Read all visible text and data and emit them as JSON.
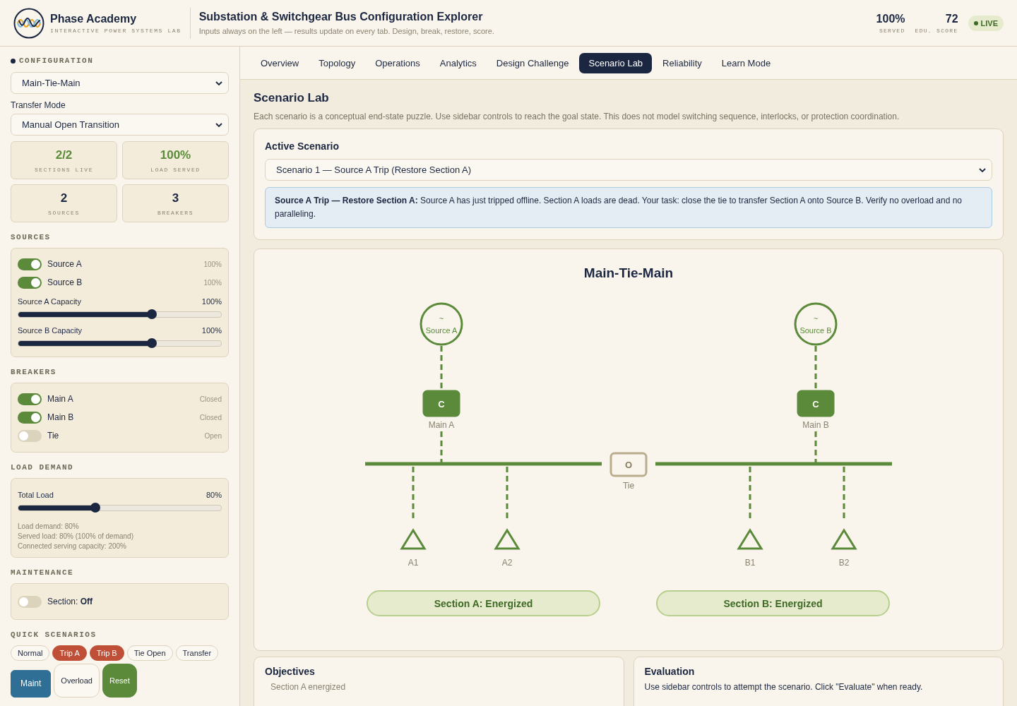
{
  "brand": {
    "name": "Phase Academy",
    "tagline": "INTERACTIVE POWER SYSTEMS LAB"
  },
  "header": {
    "title": "Substation & Switchgear Bus Configuration Explorer",
    "subtitle": "Inputs always on the left — results update on every tab. Design, break, restore, score.",
    "stats": [
      {
        "value": "100%",
        "label": "SERVED"
      },
      {
        "value": "72",
        "label": "EDU. SCORE"
      }
    ],
    "status": {
      "label": "LIVE",
      "on": true
    }
  },
  "sidebar": {
    "configuration": {
      "heading": "CONFIGURATION",
      "value": "Main-Tie-Main",
      "transfer_label": "Transfer Mode",
      "transfer_value": "Manual Open Transition"
    },
    "metrics": [
      {
        "value": "2/2",
        "label": "SECTIONS LIVE",
        "kind": "good"
      },
      {
        "value": "100%",
        "label": "LOAD SERVED",
        "kind": "good"
      },
      {
        "value": "2",
        "label": "SOURCES",
        "kind": "plain"
      },
      {
        "value": "3",
        "label": "BREAKERS",
        "kind": "plain"
      }
    ],
    "sources": {
      "heading": "SOURCES",
      "toggles": [
        {
          "label": "Source A",
          "on": true,
          "reading": "100%"
        },
        {
          "label": "Source B",
          "on": true,
          "reading": "100%"
        }
      ],
      "sliders": [
        {
          "label": "Source A Capacity",
          "reading": "100%",
          "level": 0.66
        },
        {
          "label": "Source B Capacity",
          "reading": "100%",
          "level": 0.66
        }
      ]
    },
    "breakers": {
      "heading": "BREAKERS",
      "toggles": [
        {
          "label": "Main A",
          "on": true,
          "reading": "Closed"
        },
        {
          "label": "Main B",
          "on": true,
          "reading": "Closed"
        },
        {
          "label": "Tie",
          "on": false,
          "reading": "Open"
        }
      ]
    },
    "load_demand": {
      "heading": "LOAD DEMAND",
      "slider": {
        "label": "Total Load",
        "reading": "80%",
        "level": 0.38
      },
      "notes": [
        "Load demand: 80%",
        "Served load: 80% (100% of demand)",
        "Connected serving capacity: 200%"
      ]
    },
    "maintenance": {
      "heading": "MAINTENANCE",
      "toggle": {
        "label": "Section: **Off**",
        "on": false
      }
    },
    "quick_scenarios": {
      "heading": "QUICK SCENARIOS",
      "chips": [
        {
          "label": "Normal",
          "kind": "plain"
        },
        {
          "label": "Trip A",
          "kind": "danger"
        },
        {
          "label": "Trip B",
          "kind": "danger"
        },
        {
          "label": "Tie Open",
          "kind": "plain"
        },
        {
          "label": "Transfer",
          "kind": "plain"
        },
        {
          "label": "Maint",
          "kind": "info"
        },
        {
          "label": "Overload",
          "kind": "plain"
        },
        {
          "label": "Reset",
          "kind": "success"
        }
      ]
    }
  },
  "tabs": [
    {
      "label": "Overview",
      "selected": false
    },
    {
      "label": "Topology",
      "selected": false
    },
    {
      "label": "Operations",
      "selected": false
    },
    {
      "label": "Analytics",
      "selected": false
    },
    {
      "label": "Design Challenge",
      "selected": false
    },
    {
      "label": "Scenario Lab",
      "selected": true
    },
    {
      "label": "Reliability",
      "selected": false
    },
    {
      "label": "Learn Mode",
      "selected": false
    }
  ],
  "scenario_lab": {
    "title": "Scenario Lab",
    "description": "Each scenario is a conceptual end-state puzzle. Use sidebar controls to reach the goal state. This does not model switching sequence, interlocks, or protection coordination.",
    "active": {
      "heading": "Active Scenario",
      "value": "Scenario 1 — Source A Trip (Restore Section A)",
      "info": "**Source A Trip — Restore Section A:** Source A has just tripped offline. Section A loads are dead. Your task: close the tie to transfer Section A onto Source B. Verify no overload and no paralleling."
    },
    "diagram": {
      "title": "Main-Tie-Main",
      "sources": [
        {
          "symbol": "~",
          "label": "Source A",
          "energized": true
        },
        {
          "symbol": "~",
          "label": "Source B",
          "energized": true
        }
      ],
      "breakers": [
        {
          "symbol": "C",
          "label": "Main A",
          "closed": true
        },
        {
          "symbol": "C",
          "label": "Main B",
          "closed": true
        }
      ],
      "tie": {
        "symbol": "O",
        "label": "Tie",
        "closed": false
      },
      "loads": [
        {
          "label": "A1",
          "energized": true
        },
        {
          "label": "A2",
          "energized": true
        },
        {
          "label": "B1",
          "energized": true
        },
        {
          "label": "B2",
          "energized": true
        }
      ],
      "sections": [
        {
          "label": "Section A: Energized",
          "energized": true
        },
        {
          "label": "Section B: Energized",
          "energized": true
        }
      ]
    },
    "objectives": {
      "heading": "Objectives",
      "items": [
        "Section A energized"
      ]
    },
    "evaluation": {
      "heading": "Evaluation",
      "text": "Use sidebar controls to attempt the scenario. Click \"Evaluate\" when ready."
    }
  }
}
